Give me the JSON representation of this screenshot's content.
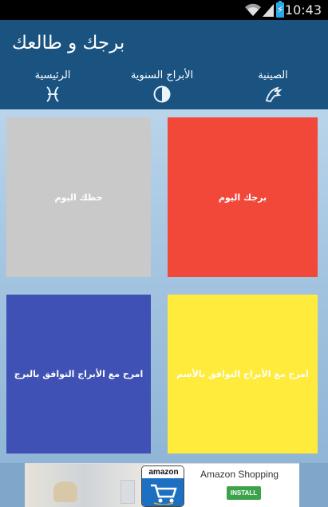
{
  "status_bar": {
    "time": "10:43"
  },
  "app_bar": {
    "title": "برجك و طالعك"
  },
  "tabs": [
    {
      "label": "الصينية",
      "icon": "dragon-icon"
    },
    {
      "label": "الأبراج السنوية",
      "icon": "half-moon-icon"
    },
    {
      "label": "الرئيسية",
      "icon": "pisces-icon"
    }
  ],
  "tiles": {
    "daily_luck": {
      "label": "حظك اليوم",
      "color": "#c9c9c9"
    },
    "daily_sign": {
      "label": "برجك اليوم",
      "color": "#f1483a"
    },
    "compat_sign": {
      "label": "امرح مع الأبراج التوافق بالبرج",
      "color": "#3f51b5"
    },
    "compat_name": {
      "label": "امرح مع الأبراج التوافق بالأسم",
      "color": "#ffeb3b"
    }
  },
  "ad": {
    "brand": "amazon",
    "name": "Amazon Shopping",
    "cta": "INSTALL"
  }
}
